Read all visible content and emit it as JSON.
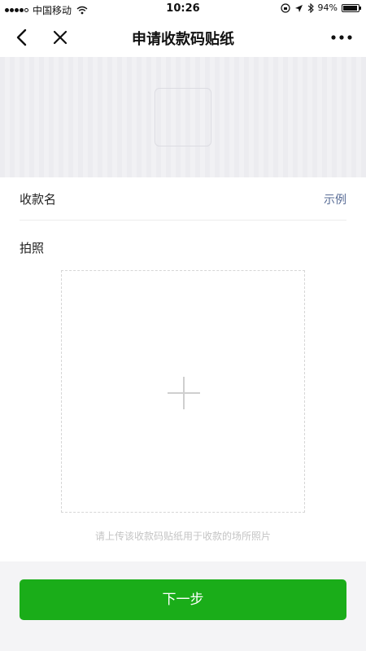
{
  "status_bar": {
    "carrier": "中国移动",
    "time": "10:26",
    "battery": "94%",
    "battery_level": 0.94,
    "icons": [
      "signal-icon",
      "wifi-icon",
      "orientation-lock-icon",
      "location-icon",
      "bluetooth-icon",
      "battery-icon"
    ]
  },
  "nav": {
    "title": "申请收款码贴纸",
    "back_icon": "chevron-left-icon",
    "close_icon": "close-icon",
    "more_icon": "more-icon"
  },
  "form": {
    "name_label": "收款名",
    "example_link": "示例",
    "photo_label": "拍照",
    "upload_hint": "请上传该收款码贴纸用于收款的场所照片"
  },
  "actions": {
    "next_label": "下一步"
  },
  "colors": {
    "primary": "#1aad19",
    "link": "#576b95",
    "background": "#f4f4f6"
  }
}
